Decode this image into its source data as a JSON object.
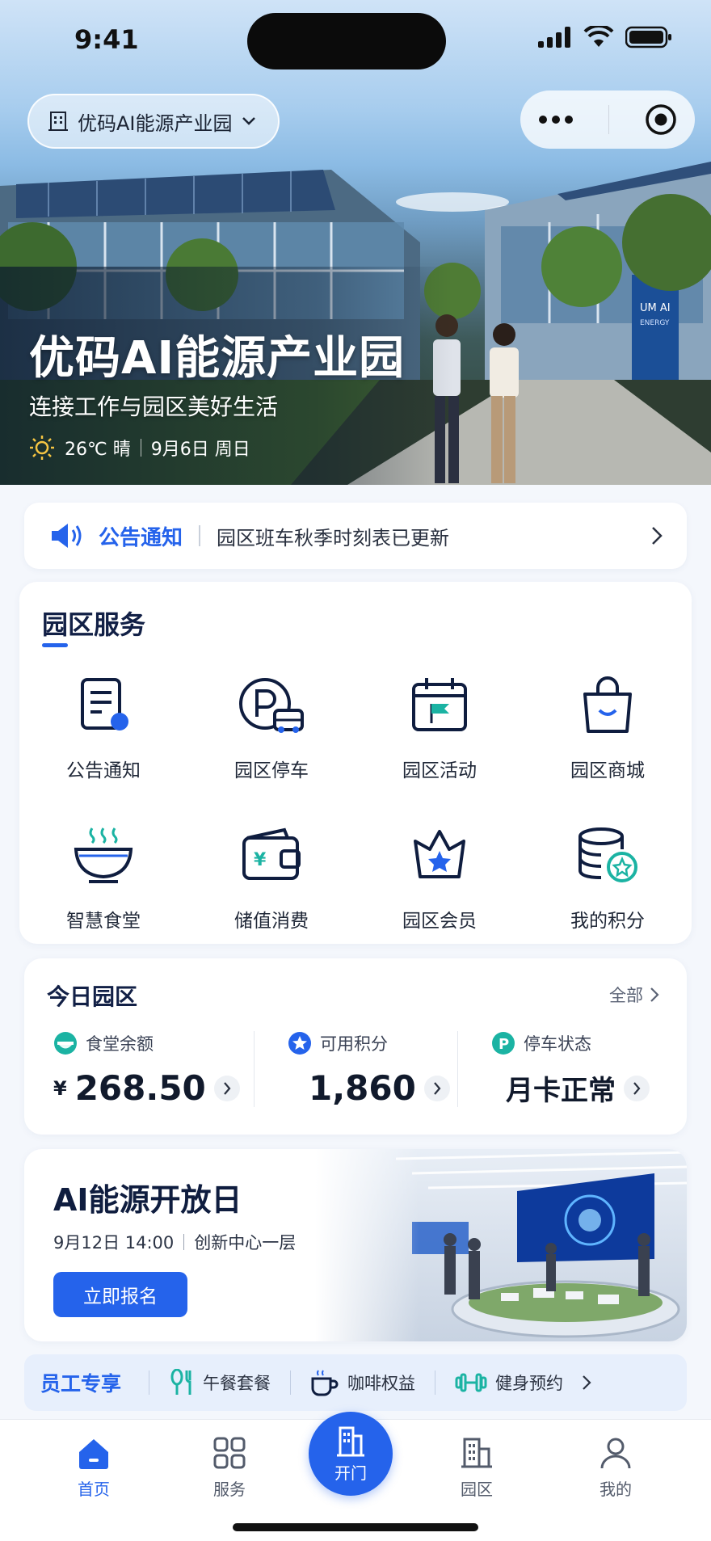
{
  "status": {
    "time": "9:41"
  },
  "header": {
    "park_name": "优码AI能源产业园"
  },
  "hero": {
    "title": "优码AI能源产业园",
    "subtitle": "连接工作与园区美好生活",
    "temperature": "26℃ 晴",
    "date": "9月6日 周日",
    "sign_text": "UM AI",
    "sign_sub": "ENERGY"
  },
  "notice": {
    "tag": "公告通知",
    "text": "园区班车秋季时刻表已更新"
  },
  "services": {
    "title": "园区服务",
    "items": [
      {
        "label": "公告通知",
        "icon": "notice-doc-icon"
      },
      {
        "label": "园区停车",
        "icon": "parking-icon"
      },
      {
        "label": "园区活动",
        "icon": "calendar-flag-icon"
      },
      {
        "label": "园区商城",
        "icon": "shopping-bag-icon"
      },
      {
        "label": "智慧食堂",
        "icon": "food-bowl-icon"
      },
      {
        "label": "储值消费",
        "icon": "wallet-icon"
      },
      {
        "label": "园区会员",
        "icon": "member-star-icon"
      },
      {
        "label": "我的积分",
        "icon": "points-coin-icon"
      }
    ]
  },
  "today": {
    "title": "今日园区",
    "all_label": "全部",
    "stats": [
      {
        "label": "食堂余额",
        "currency": "¥",
        "value": "268.50"
      },
      {
        "label": "可用积分",
        "value": "1,860"
      },
      {
        "label": "停车状态",
        "value": "月卡正常"
      }
    ]
  },
  "event": {
    "title": "AI能源开放日",
    "date": "9月12日 14:00",
    "location": "创新中心一层",
    "button": "立即报名"
  },
  "perks": {
    "title": "员工专享",
    "items": [
      {
        "label": "午餐套餐"
      },
      {
        "label": "咖啡权益"
      },
      {
        "label": "健身预约"
      }
    ]
  },
  "tabbar": {
    "items": [
      {
        "label": "首页"
      },
      {
        "label": "服务"
      },
      {
        "label": "开门"
      },
      {
        "label": "园区"
      },
      {
        "label": "我的"
      }
    ]
  },
  "colors": {
    "primary": "#2563eb",
    "teal": "#1bb3a3"
  }
}
